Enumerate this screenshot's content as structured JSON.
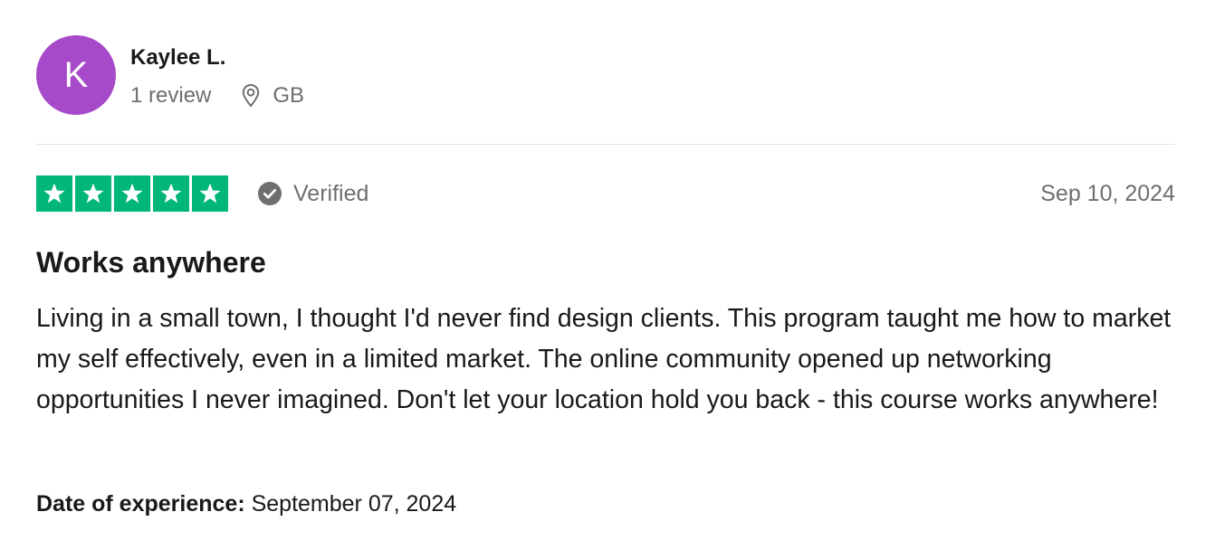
{
  "reviewer": {
    "initial": "K",
    "name": "Kaylee L.",
    "review_count": "1 review",
    "country": "GB",
    "avatar_color": "#a64ac9"
  },
  "review": {
    "rating": 5,
    "rating_max": 5,
    "star_color": "#00b67a",
    "verified_label": "Verified",
    "date": "Sep 10, 2024",
    "title": "Works anywhere",
    "body": "Living in a small town, I thought I'd never find design clients. This program taught me how to market my self effectively, even in a limited market. The online community opened up networking opportunities I never imagined. Don't let your location hold you back - this course works anywhere!",
    "experience_label": "Date of experience:",
    "experience_date": "September 07, 2024"
  },
  "icons": {
    "location": "location-pin-icon",
    "verified": "check-circle-icon",
    "star": "star-icon"
  }
}
